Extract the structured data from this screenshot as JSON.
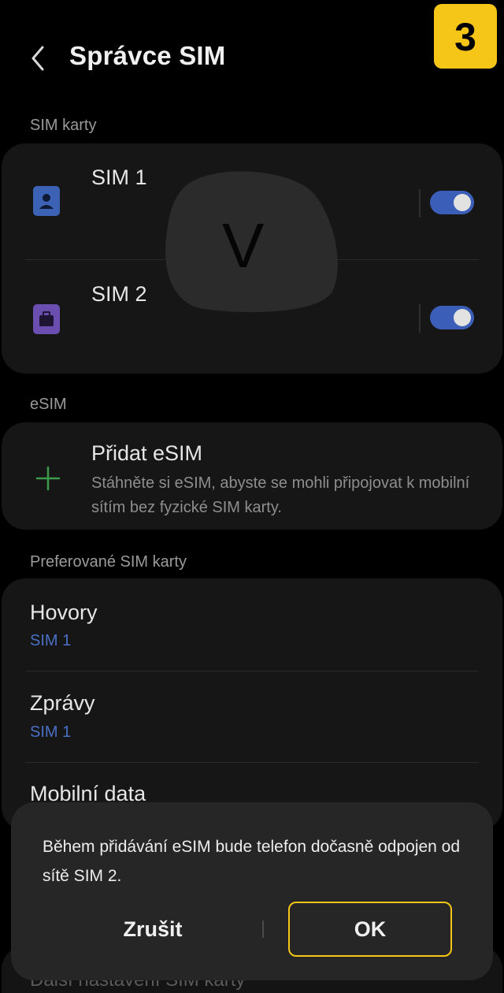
{
  "header": {
    "title": "Správce SIM",
    "step_badge": "3"
  },
  "sections": {
    "sim_cards": "SIM karty",
    "esim": "eSIM",
    "preferred": "Preferované SIM karty"
  },
  "sims": [
    {
      "name": "SIM 1",
      "enabled": true,
      "icon": "person-sim-icon",
      "color": "#3b62b5"
    },
    {
      "name": "SIM 2",
      "enabled": true,
      "icon": "briefcase-sim-icon",
      "color": "#6b4fb0"
    }
  ],
  "overlay": {
    "letter": "V"
  },
  "add_esim": {
    "title": "Přidat eSIM",
    "description": "Stáhněte si eSIM, abyste se mohli připojovat k mobilní sítím bez fyzické SIM karty."
  },
  "preferred": [
    {
      "label": "Hovory",
      "value": "SIM 1"
    },
    {
      "label": "Zprávy",
      "value": "SIM 1"
    },
    {
      "label": "Mobilní data"
    }
  ],
  "dialog": {
    "message": "Během přidávání eSIM bude telefon dočasně odpojen od sítě SIM 2.",
    "cancel": "Zrušit",
    "ok": "OK"
  },
  "footer_peek": "Další nastavení SIM karty",
  "colors": {
    "accent": "#3b5fb8",
    "highlight": "#f5c518",
    "link": "#4a6fc4"
  }
}
